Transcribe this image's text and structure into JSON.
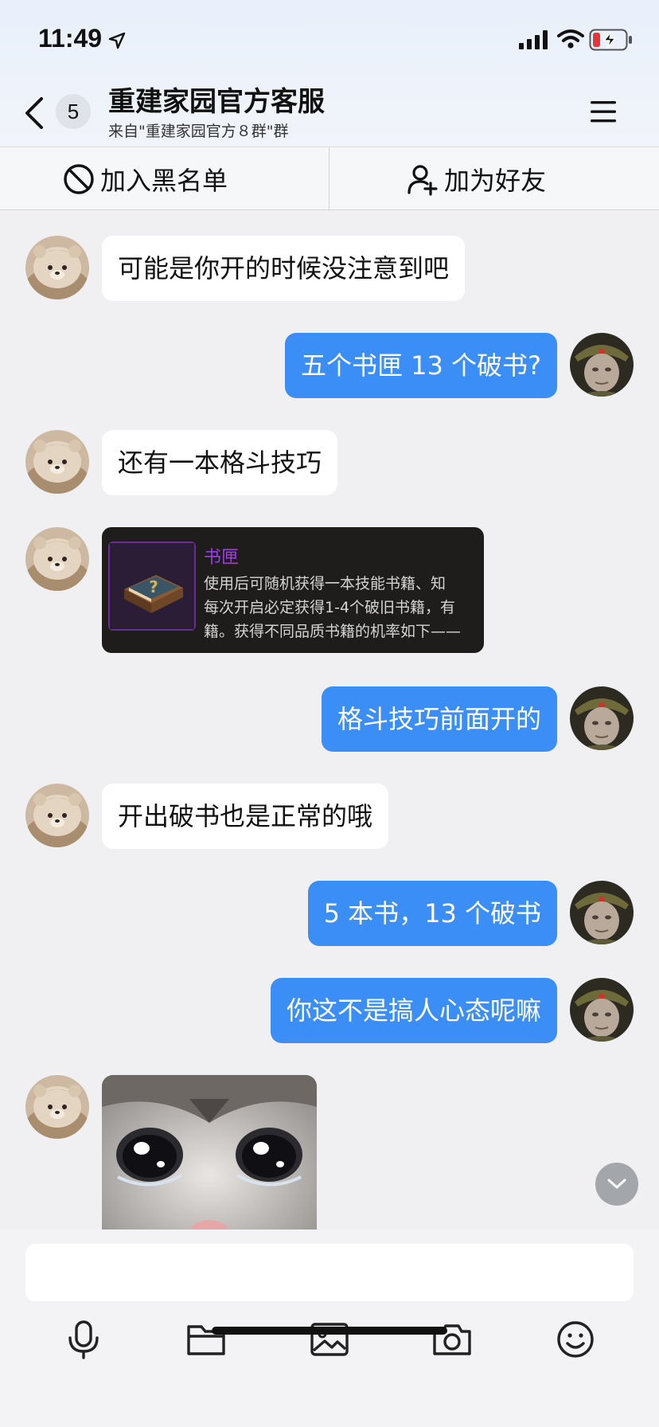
{
  "status_bar": {
    "time": "11:49",
    "icons": [
      "location-arrow-icon",
      "cellular-signal-icon",
      "wifi-icon",
      "battery-charging-icon"
    ]
  },
  "nav": {
    "back_icon": "chevron-left-icon",
    "unread_count": "5",
    "title": "重建家园官方客服",
    "subtitle": "来自\"重建家园官方８群\"群",
    "menu_icon": "hamburger-menu-icon"
  },
  "actions": {
    "blacklist": {
      "label": "加入黑名单",
      "icon": "block-icon"
    },
    "add_friend": {
      "label": "加为好友",
      "icon": "add-user-icon"
    }
  },
  "messages": [
    {
      "side": "in",
      "type": "text",
      "text": "可能是你开的时候没注意到吧"
    },
    {
      "side": "out",
      "type": "text",
      "text": "五个书匣 13 个破书?"
    },
    {
      "side": "in",
      "type": "text",
      "text": "还有一本格斗技巧"
    },
    {
      "side": "in",
      "type": "image",
      "item_card": {
        "name": "书匣",
        "desc_lines": [
          "使用后可随机获得一本技能书籍、知",
          "每次开启必定获得1-4个破旧书籍，有",
          "籍。获得不同品质书籍的机率如下——"
        ]
      }
    },
    {
      "side": "out",
      "type": "text",
      "text": "格斗技巧前面开的"
    },
    {
      "side": "in",
      "type": "text",
      "text": "开出破书也是正常的哦"
    },
    {
      "side": "out",
      "type": "text",
      "text": "5 本书，13 个破书"
    },
    {
      "side": "out",
      "type": "text",
      "text": "你这不是搞人心态呢嘛"
    },
    {
      "side": "in",
      "type": "sticker",
      "sticker": "crying-cat-sticker"
    }
  ],
  "input": {
    "placeholder": "",
    "toolbar": [
      "microphone-icon",
      "folder-icon",
      "image-icon",
      "camera-icon",
      "emoji-icon"
    ]
  },
  "colors": {
    "outgoing_bubble": "#3a8ef6",
    "incoming_bubble": "#ffffff",
    "chat_background": "#f0f0f3",
    "item_name": "#9b3fe0"
  }
}
